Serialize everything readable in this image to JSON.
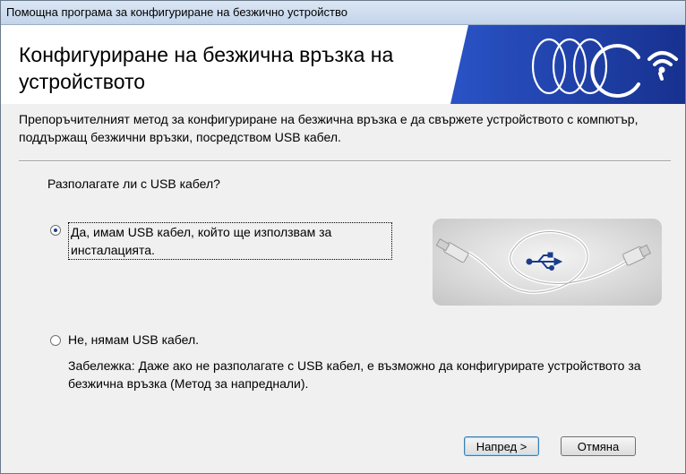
{
  "window": {
    "title": "Помощна програма за конфигуриране на безжично устройство"
  },
  "header": {
    "title": "Конфигуриране на безжична връзка на устройството",
    "banner_icon": "wireless-signal-icon"
  },
  "description": "Препоръчителният метод за конфигуриране на безжична връзка е да свържете устройството с компютър, поддържащ безжични връзки, посредством USB кабел.",
  "question": "Разполагате ли с USB кабел?",
  "options": [
    {
      "label": "Да, имам USB кабел, който ще използвам за инсталацията.",
      "selected": true
    },
    {
      "label": "Не, нямам USB кабел.",
      "selected": false
    }
  ],
  "note": "Забележка: Даже ако не разполагате с USB кабел, е възможно да конфигурирате устройството за безжична връзка (Метод за напреднали).",
  "illustration": {
    "icon": "usb-cable-icon"
  },
  "buttons": {
    "next": "Напред >",
    "cancel": "Отмяна"
  },
  "colors": {
    "banner_blue": "#1f3fa8",
    "accent": "#3c7fb1"
  }
}
